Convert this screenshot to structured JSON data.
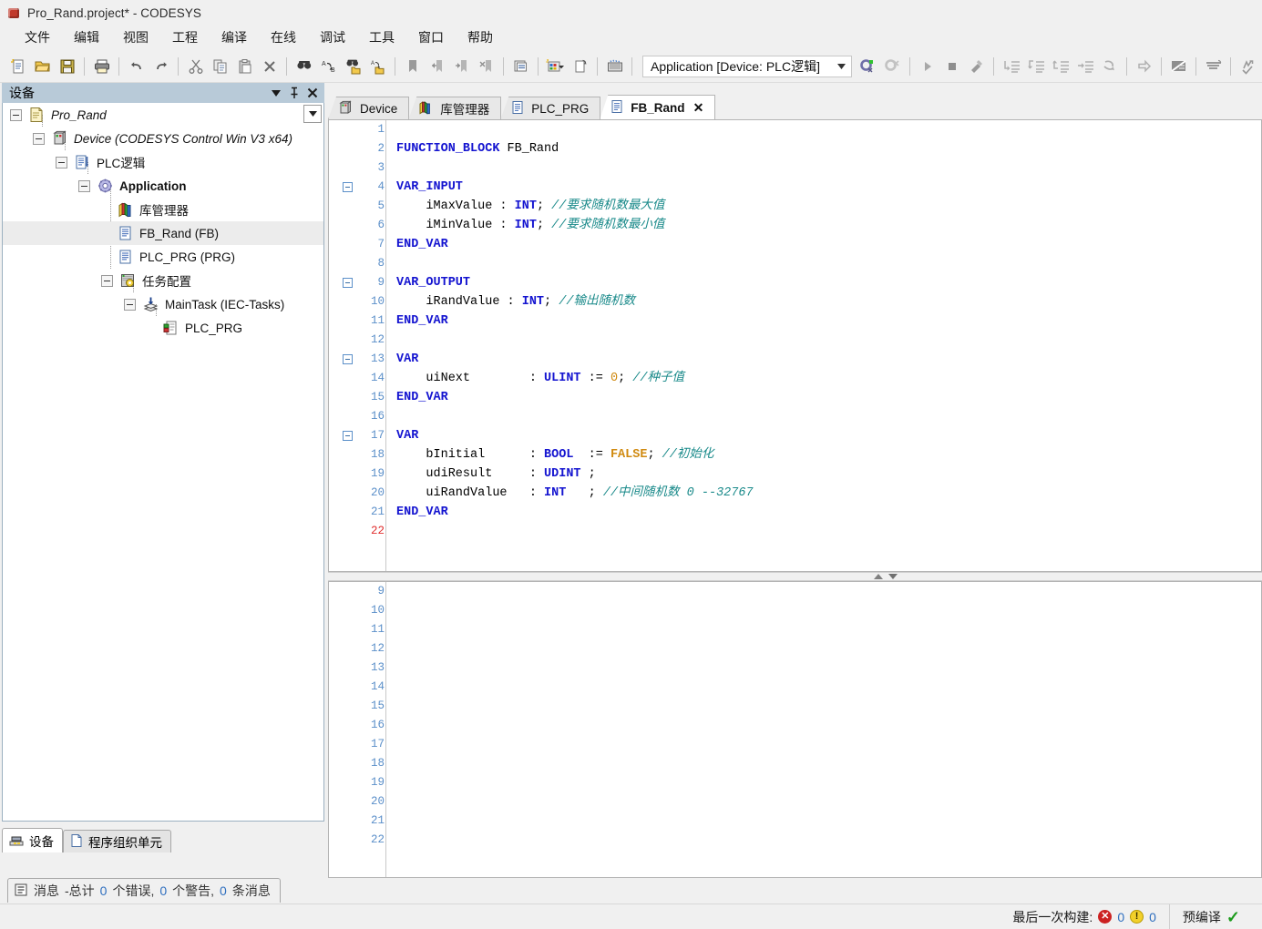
{
  "window": {
    "title": "Pro_Rand.project* - CODESYS",
    "logo_icon": "codesys-cube-icon"
  },
  "menu": {
    "items": [
      {
        "label": "文件",
        "name": "menu-file"
      },
      {
        "label": "编辑",
        "name": "menu-edit"
      },
      {
        "label": "视图",
        "name": "menu-view"
      },
      {
        "label": "工程",
        "name": "menu-project"
      },
      {
        "label": "编译",
        "name": "menu-build"
      },
      {
        "label": "在线",
        "name": "menu-online"
      },
      {
        "label": "调试",
        "name": "menu-debug"
      },
      {
        "label": "工具",
        "name": "menu-tools"
      },
      {
        "label": "窗口",
        "name": "menu-window"
      },
      {
        "label": "帮助",
        "name": "menu-help"
      }
    ]
  },
  "toolbar": {
    "icons": [
      "new-project-icon",
      "open-project-icon",
      "save-project-icon",
      "print-icon",
      "undo-icon",
      "redo-icon",
      "cut-icon",
      "copy-icon",
      "paste-icon",
      "delete-icon",
      "find-icon",
      "replace-icon",
      "find-in-project-icon",
      "replace-in-project-icon",
      "toggle-bookmark-icon",
      "previous-bookmark-icon",
      "next-bookmark-icon",
      "clear-bookmarks-icon",
      "properties-icon",
      "add-object-icon",
      "add-folder-icon",
      "device-update-icon"
    ],
    "application_selector": {
      "value": "Application [Device: PLC逻辑]",
      "dropdown_icon": "chevron-down-icon"
    },
    "online_icons": [
      "login-icon",
      "logout-icon"
    ],
    "debug_icons": [
      "start-icon",
      "stop-icon",
      "build-icon",
      "step-over-icon",
      "step-into-icon",
      "step-out-icon",
      "run-to-cursor-icon",
      "set-next-statement-icon",
      "show-next-statement-icon",
      "toggle-breakpoint-icon",
      "watch-icon",
      "flow-control-icon"
    ]
  },
  "device_panel": {
    "title": "设备",
    "header_icons": [
      "chevron-down-icon",
      "pin-icon",
      "close-icon"
    ],
    "dropdown_icon": "chevron-down-icon",
    "tree": [
      {
        "label": "Pro_Rand",
        "indent": 0,
        "icon": "project-icon",
        "expander": "minus",
        "style": "italic",
        "selected": false
      },
      {
        "label": "Device (CODESYS Control Win V3 x64)",
        "indent": 1,
        "icon": "device-icon",
        "expander": "minus",
        "style": "italic",
        "selected": false
      },
      {
        "label": "PLC逻辑",
        "indent": 2,
        "icon": "plc-logic-icon",
        "expander": "minus",
        "style": "normal",
        "selected": false
      },
      {
        "label": "Application",
        "indent": 3,
        "icon": "application-icon",
        "expander": "minus",
        "style": "bold",
        "selected": false
      },
      {
        "label": "库管理器",
        "indent": 4,
        "icon": "library-manager-icon",
        "expander": "none",
        "style": "normal",
        "selected": false
      },
      {
        "label": "FB_Rand (FB)",
        "indent": 4,
        "icon": "pou-fb-icon",
        "expander": "none",
        "style": "normal",
        "selected": true
      },
      {
        "label": "PLC_PRG (PRG)",
        "indent": 4,
        "icon": "pou-prg-icon",
        "expander": "none",
        "style": "normal",
        "selected": false
      },
      {
        "label": "任务配置",
        "indent": 3,
        "icon": "task-config-icon",
        "expander": "minus",
        "style": "normal",
        "selected": false
      },
      {
        "label": "MainTask (IEC-Tasks)",
        "indent": 4,
        "icon": "task-icon",
        "expander": "minus",
        "style": "normal",
        "selected": false
      },
      {
        "label": "PLC_PRG",
        "indent": 5,
        "icon": "task-call-icon",
        "expander": "none",
        "style": "normal",
        "selected": false
      }
    ],
    "bottom_tabs": [
      {
        "label": "设备",
        "name": "dock-tab-devices",
        "icon": "devices-icon",
        "active": true
      },
      {
        "label": "程序组织单元",
        "name": "dock-tab-pous",
        "icon": "pou-icon",
        "active": false
      }
    ]
  },
  "editor": {
    "tabs": [
      {
        "label": "Device",
        "icon": "device-icon",
        "active": false,
        "closable": false
      },
      {
        "label": "库管理器",
        "icon": "library-manager-icon",
        "active": false,
        "closable": false
      },
      {
        "label": "PLC_PRG",
        "icon": "pou-prg-icon",
        "active": false,
        "closable": false
      },
      {
        "label": "FB_Rand",
        "icon": "pou-fb-icon",
        "active": true,
        "closable": true,
        "close_icon": "close-icon"
      }
    ],
    "declaration_pane": {
      "first_line": 1,
      "lines": [
        {
          "n": 1,
          "fold": false,
          "tokens": []
        },
        {
          "n": 2,
          "fold": false,
          "tokens": [
            {
              "t": "FUNCTION_BLOCK",
              "c": "kw"
            },
            {
              "t": " FB_Rand",
              "c": ""
            }
          ]
        },
        {
          "n": 3,
          "fold": false,
          "tokens": []
        },
        {
          "n": 4,
          "fold": true,
          "tokens": [
            {
              "t": "VAR_INPUT",
              "c": "kw"
            }
          ]
        },
        {
          "n": 5,
          "fold": false,
          "tokens": [
            {
              "t": "    iMaxValue : ",
              "c": ""
            },
            {
              "t": "INT",
              "c": "ty"
            },
            {
              "t": "; ",
              "c": ""
            },
            {
              "t": "//要求随机数最大值",
              "c": "cm"
            }
          ]
        },
        {
          "n": 6,
          "fold": false,
          "tokens": [
            {
              "t": "    iMinValue : ",
              "c": ""
            },
            {
              "t": "INT",
              "c": "ty"
            },
            {
              "t": "; ",
              "c": ""
            },
            {
              "t": "//要求随机数最小值",
              "c": "cm"
            }
          ]
        },
        {
          "n": 7,
          "fold": false,
          "tokens": [
            {
              "t": "END_VAR",
              "c": "kw"
            }
          ]
        },
        {
          "n": 8,
          "fold": false,
          "tokens": []
        },
        {
          "n": 9,
          "fold": true,
          "tokens": [
            {
              "t": "VAR_OUTPUT",
              "c": "kw"
            }
          ]
        },
        {
          "n": 10,
          "fold": false,
          "tokens": [
            {
              "t": "    iRandValue : ",
              "c": ""
            },
            {
              "t": "INT",
              "c": "ty"
            },
            {
              "t": "; ",
              "c": ""
            },
            {
              "t": "//输出随机数",
              "c": "cm"
            }
          ]
        },
        {
          "n": 11,
          "fold": false,
          "tokens": [
            {
              "t": "END_VAR",
              "c": "kw"
            }
          ]
        },
        {
          "n": 12,
          "fold": false,
          "tokens": []
        },
        {
          "n": 13,
          "fold": true,
          "tokens": [
            {
              "t": "VAR",
              "c": "kw"
            }
          ]
        },
        {
          "n": 14,
          "fold": false,
          "tokens": [
            {
              "t": "    uiNext        : ",
              "c": ""
            },
            {
              "t": "ULINT",
              "c": "ty"
            },
            {
              "t": " := ",
              "c": ""
            },
            {
              "t": "0",
              "c": "nm"
            },
            {
              "t": "; ",
              "c": ""
            },
            {
              "t": "//种子值",
              "c": "cm"
            }
          ]
        },
        {
          "n": 15,
          "fold": false,
          "tokens": [
            {
              "t": "END_VAR",
              "c": "kw"
            }
          ]
        },
        {
          "n": 16,
          "fold": false,
          "tokens": []
        },
        {
          "n": 17,
          "fold": true,
          "tokens": [
            {
              "t": "VAR",
              "c": "kw"
            }
          ]
        },
        {
          "n": 18,
          "fold": false,
          "tokens": [
            {
              "t": "    bInitial      : ",
              "c": ""
            },
            {
              "t": "BOOL",
              "c": "ty"
            },
            {
              "t": "  := ",
              "c": ""
            },
            {
              "t": "FALSE",
              "c": "bl"
            },
            {
              "t": "; ",
              "c": ""
            },
            {
              "t": "//初始化",
              "c": "cm"
            }
          ]
        },
        {
          "n": 19,
          "fold": false,
          "tokens": [
            {
              "t": "    udiResult     : ",
              "c": ""
            },
            {
              "t": "UDINT",
              "c": "ty"
            },
            {
              "t": " ;",
              "c": ""
            }
          ]
        },
        {
          "n": 20,
          "fold": false,
          "tokens": [
            {
              "t": "    uiRandValue   : ",
              "c": ""
            },
            {
              "t": "INT",
              "c": "ty"
            },
            {
              "t": "   ; ",
              "c": ""
            },
            {
              "t": "//中间随机数 0 --32767",
              "c": "cm"
            }
          ]
        },
        {
          "n": 21,
          "fold": false,
          "tokens": [
            {
              "t": "END_VAR",
              "c": "kw"
            }
          ]
        },
        {
          "n": 22,
          "fold": false,
          "current": true,
          "tokens": []
        }
      ]
    },
    "splitter": {
      "up_icon": "scroll-up-icon",
      "down_icon": "scroll-down-icon"
    },
    "implementation_pane": {
      "line_numbers": [
        9,
        10,
        11,
        12,
        13,
        14,
        15,
        16,
        17,
        18,
        19,
        20,
        21,
        22
      ]
    }
  },
  "message_bar": {
    "icon": "message-icon",
    "prefix": "消息",
    "text": "-总计",
    "errors": "0",
    "errors_suffix": "个错误,",
    "warnings": "0",
    "warnings_suffix": "个警告,",
    "messages": "0",
    "messages_suffix": "条消息"
  },
  "status_bar": {
    "last_build_label": "最后一次构建:",
    "error_icon": "error-badge-icon",
    "error_count": "0",
    "warning_icon": "warning-badge-icon",
    "warning_count": "0",
    "precompile_label": "预编译",
    "precompile_icon": "check-icon"
  },
  "colors": {
    "keyword": "#1414d0",
    "comment": "#1a8a8a",
    "number": "#d08a10",
    "line_number": "#5b8fc9",
    "current_line_number": "#e03030",
    "dock_header": "#b8cad8",
    "chrome": "#f0f0f0"
  }
}
